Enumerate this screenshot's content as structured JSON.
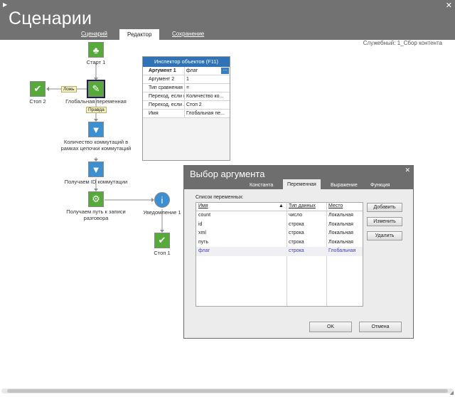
{
  "app": {
    "title": "Сценарии",
    "tabs": [
      {
        "label": "Сценарий",
        "active": false
      },
      {
        "label": "Редактор",
        "active": true
      },
      {
        "label": "Сохранение",
        "active": false
      }
    ],
    "breadcrumb": "Служебный: 1_Сбор контента"
  },
  "flow": {
    "nodes": {
      "start": {
        "label": "Старт 1",
        "icon": "runner-icon"
      },
      "global_var": {
        "label": "Глобальная переменная",
        "icon": "variable-check-icon"
      },
      "stop2": {
        "label": "Стоп 2",
        "icon": "checkmark-icon"
      },
      "count": {
        "label": "Количество коммутаций в рамках цепочки коммутаций",
        "icon": "funnel-icon"
      },
      "get_id": {
        "label": "Получаем ID коммутации",
        "icon": "funnel-icon"
      },
      "get_path": {
        "label": "Получаем путь к записи разговора",
        "icon": "script-icon"
      },
      "notify": {
        "label": "Уведомление 1",
        "icon": "info-icon"
      },
      "stop1": {
        "label": "Стоп 1",
        "icon": "checkmark-icon"
      }
    },
    "edge_labels": {
      "false": "Ложь",
      "true": "Правда"
    }
  },
  "inspector": {
    "title": "Инспектор объектов (F11)",
    "rows": [
      {
        "key": "Аргумент 1",
        "value": "флаг"
      },
      {
        "key": "Аргумент 2",
        "value": "1"
      },
      {
        "key": "Тип сравнения",
        "value": "="
      },
      {
        "key": "Переход, если ис",
        "value": "Количество ко..."
      },
      {
        "key": "Переход, если ...",
        "value": "Стоп 2"
      },
      {
        "key": "Имя",
        "value": "Глобальная пе..."
      }
    ],
    "ellipsis_button": "..."
  },
  "dialog": {
    "title": "Выбор аргумента",
    "close": "✕",
    "tabs": [
      {
        "label": "Константа",
        "active": false
      },
      {
        "label": "Переменная",
        "active": true
      },
      {
        "label": "Выражение",
        "active": false
      },
      {
        "label": "Функция",
        "active": false
      }
    ],
    "list_label": "Список переменных:",
    "columns": [
      "Имя",
      "Тип данных",
      "Место"
    ],
    "rows": [
      {
        "name": "count",
        "type": "число",
        "place": "Локальная"
      },
      {
        "name": "id",
        "type": "строка",
        "place": "Локальная"
      },
      {
        "name": "xml",
        "type": "строка",
        "place": "Локальная"
      },
      {
        "name": "путь",
        "type": "строка",
        "place": "Локальная"
      },
      {
        "name": "флаг",
        "type": "строка",
        "place": "Глобальная"
      }
    ],
    "buttons": {
      "add": "Добавить",
      "edit": "Изменить",
      "delete": "Удалить",
      "ok": "OK",
      "cancel": "Отмена"
    }
  },
  "colors": {
    "header": "#727272",
    "accent": "#2f73b6",
    "node_green": "#55aa3a",
    "node_blue": "#3c8fd0"
  }
}
